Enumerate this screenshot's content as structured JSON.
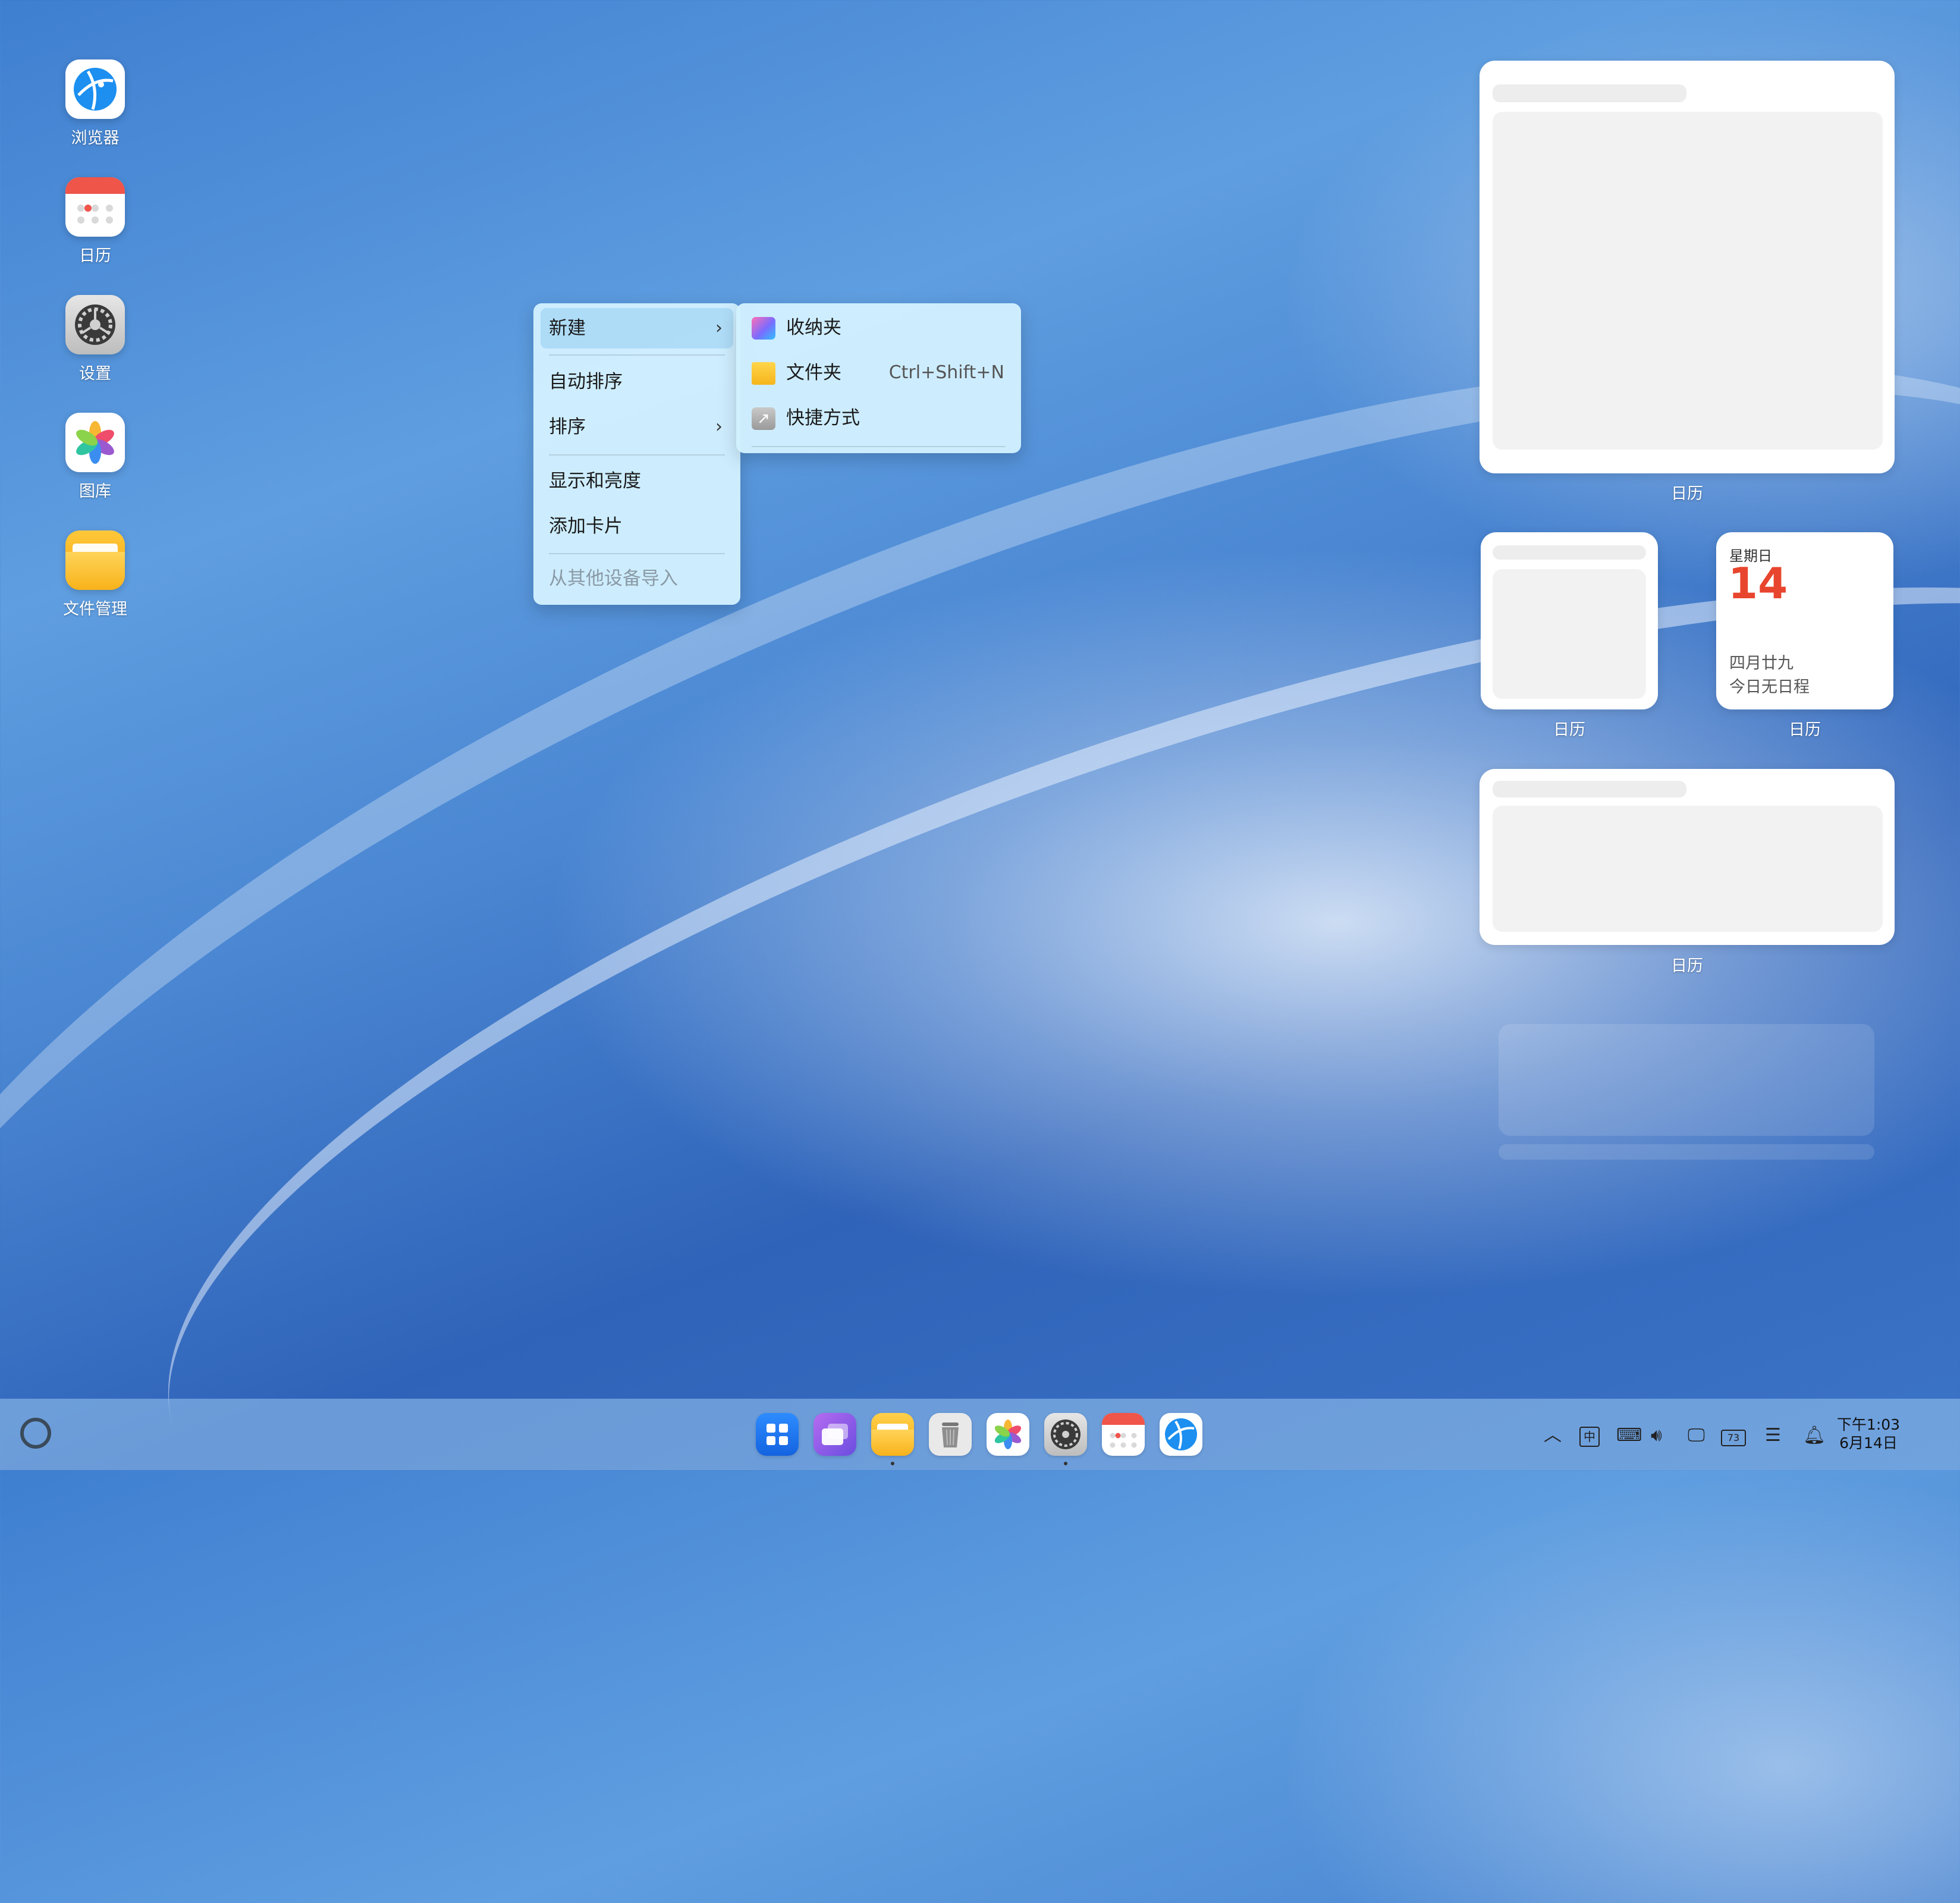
{
  "desktop_icons": [
    {
      "label": "浏览器",
      "icon": "browser-icon"
    },
    {
      "label": "日历",
      "icon": "calendar-icon"
    },
    {
      "label": "设置",
      "icon": "settings-gear-icon"
    },
    {
      "label": "图库",
      "icon": "gallery-flower-icon"
    },
    {
      "label": "文件管理",
      "icon": "folder-icon"
    }
  ],
  "context_menu": {
    "new": "新建",
    "auto_sort": "自动排序",
    "sort": "排序",
    "display_brightness": "显示和亮度",
    "add_card": "添加卡片",
    "import_from_other_device": "从其他设备导入"
  },
  "submenu": {
    "collection": "收纳夹",
    "folder": "文件夹",
    "folder_shortcut": "Ctrl+Shift+N",
    "shortcut": "快捷方式"
  },
  "widgets": {
    "large_label": "日历",
    "small_left_label": "日历",
    "date_card": {
      "weekday": "星期日",
      "day": "14",
      "lunar": "四月廿九",
      "schedule": "今日无日程",
      "label": "日历"
    },
    "wide_label": "日历"
  },
  "taskbar": {
    "apps": [
      "app-center-icon",
      "multitask-icon",
      "file-manager-icon",
      "trash-icon",
      "gallery-icon",
      "settings-icon",
      "calendar-icon",
      "browser-icon"
    ],
    "tray": {
      "ime": "中",
      "battery": "73",
      "time": "下午1:03",
      "date": "6月14日"
    }
  },
  "colors": {
    "accent_red": "#e8452e",
    "menu_bg": "#d2f0ff",
    "taskbar_bg": "#9bc8f0"
  }
}
